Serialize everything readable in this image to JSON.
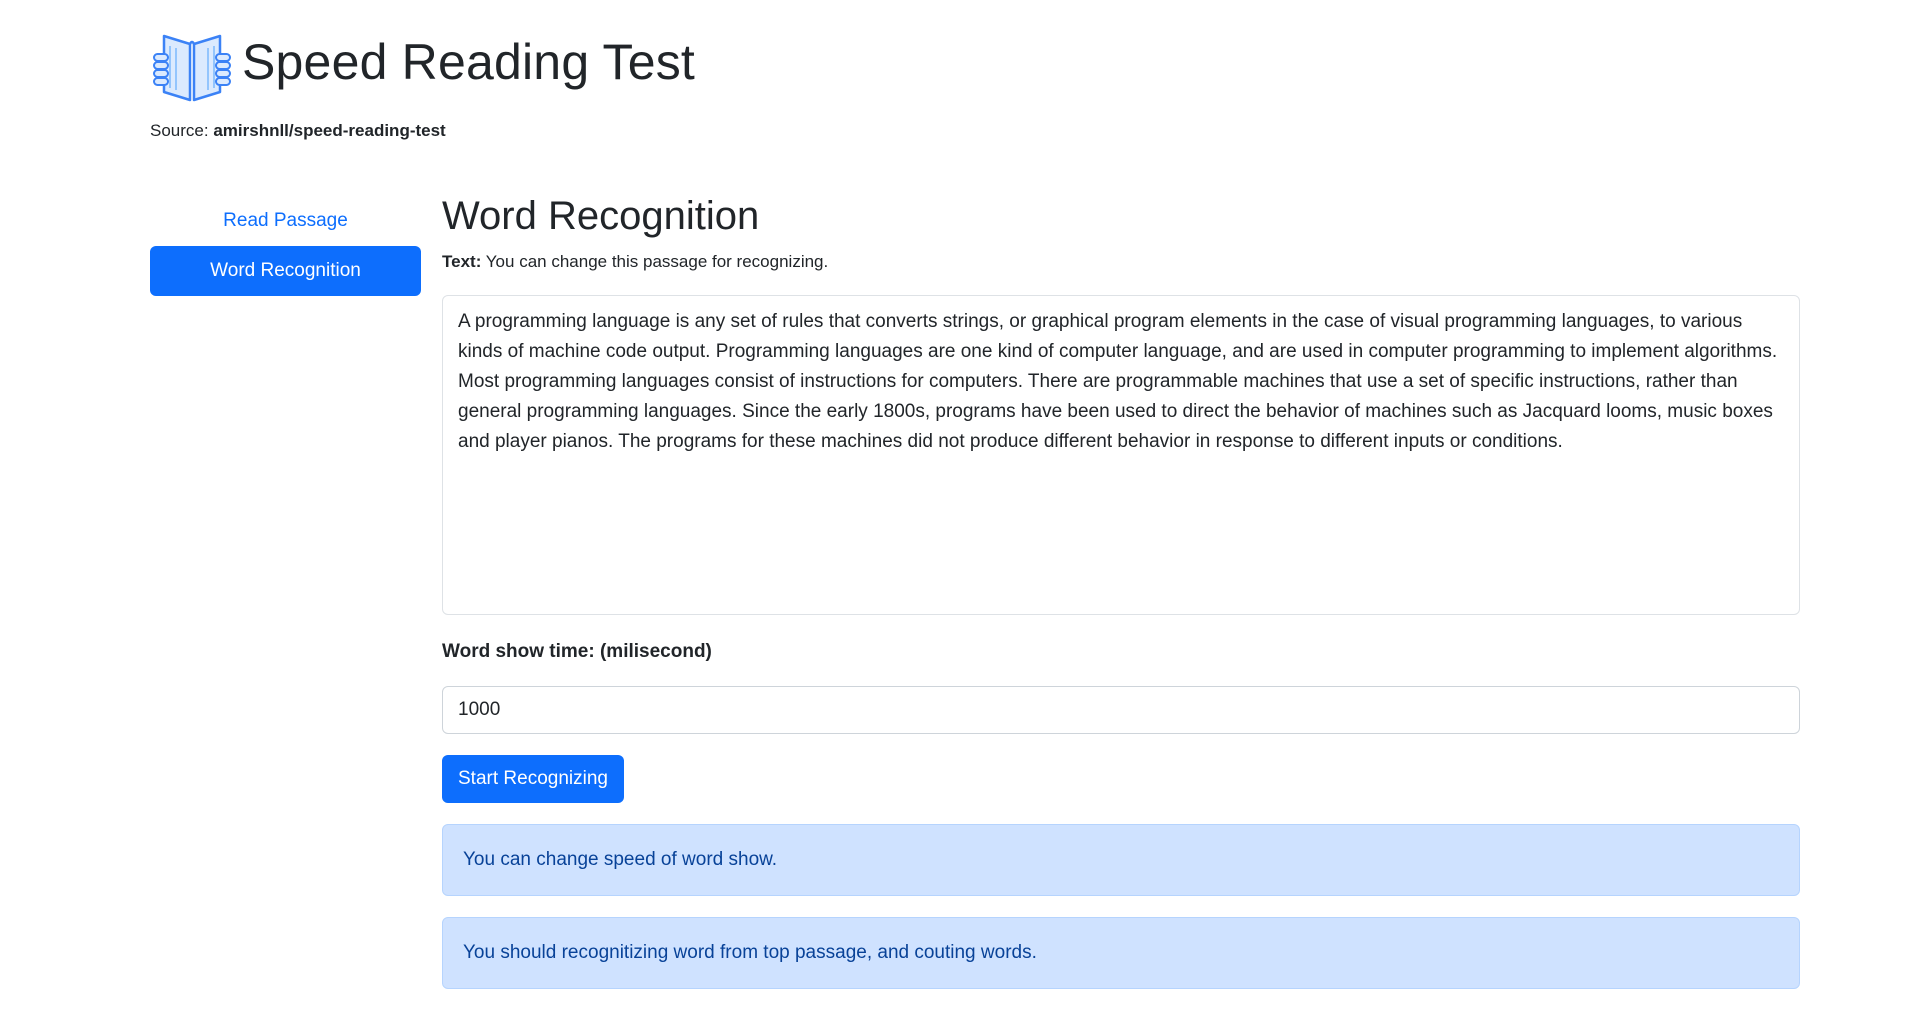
{
  "header": {
    "title": "Speed Reading Test",
    "source_label": "Source:",
    "source_value": "amirshnll/speed-reading-test",
    "logo_icon": "open-book-icon"
  },
  "sidebar": {
    "items": [
      {
        "label": "Read Passage",
        "active": false
      },
      {
        "label": "Word Recognition",
        "active": true
      }
    ]
  },
  "main": {
    "title": "Word Recognition",
    "text_label": "Text:",
    "text_hint": "You can change this passage for recognizing.",
    "passage": "A programming language is any set of rules that converts strings, or graphical program elements in the case of visual programming languages, to various kinds of machine code output. Programming languages are one kind of computer language, and are used in computer programming to implement algorithms. Most programming languages consist of instructions for computers. There are programmable machines that use a set of specific instructions, rather than general programming languages. Since the early 1800s, programs have been used to direct the behavior of machines such as Jacquard looms, music boxes and player pianos. The programs for these machines did not produce different behavior in response to different inputs or conditions.",
    "time_label": "Word show time: (milisecond)",
    "time_value": "1000",
    "start_button": "Start Recognizing",
    "alerts": [
      "You can change speed of word show.",
      "You should recognitizing word from top passage, and couting words."
    ]
  },
  "colors": {
    "primary": "#0d6efd",
    "alert_bg": "#cfe2ff",
    "alert_text": "#084298"
  }
}
